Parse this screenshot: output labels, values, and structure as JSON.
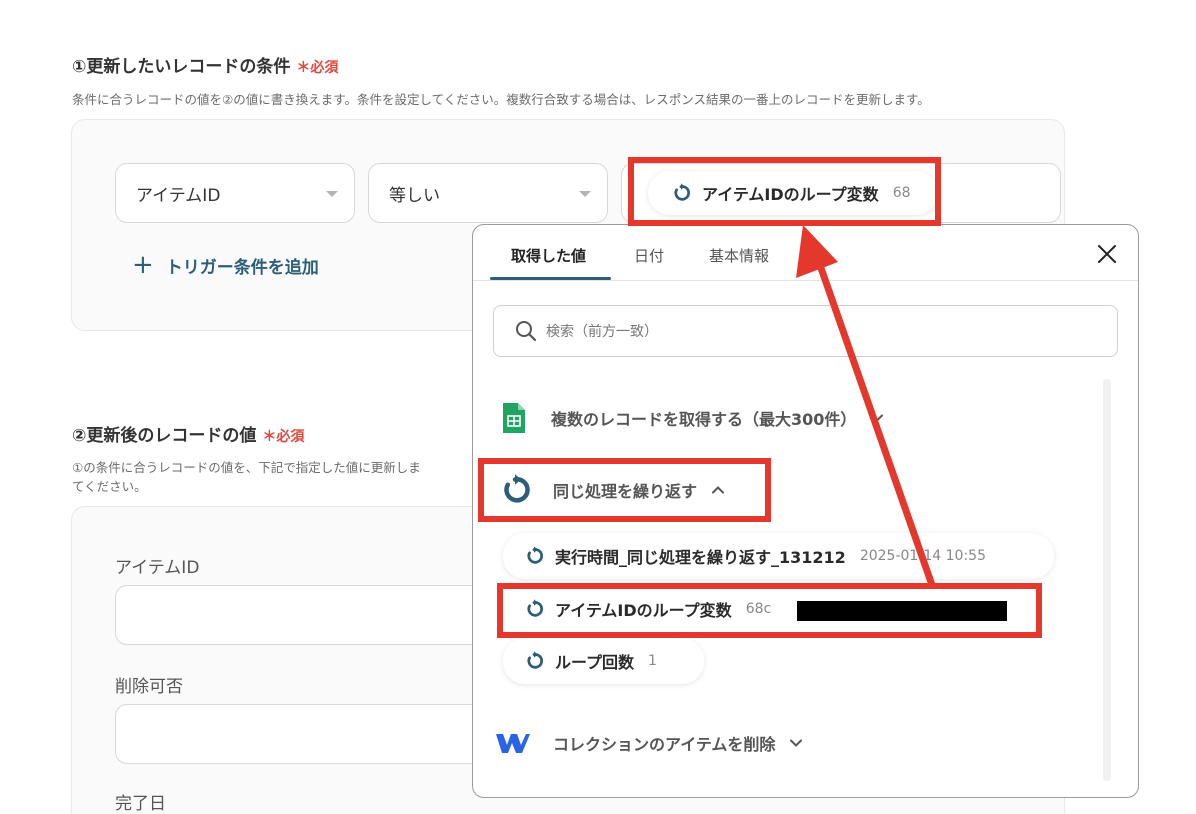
{
  "section1": {
    "title": "①更新したいレコードの条件",
    "required": "＊必須",
    "description": "条件に合うレコードの値を②の値に書き換えます。条件を設定してください。複数行合致する場合は、レスポンス結果の一番上のレコードを更新します。",
    "field_select": "アイテムID",
    "operator_select": "等しい",
    "value_chip": {
      "label": "アイテムIDのループ変数",
      "value": "68"
    },
    "add_condition": "トリガー条件を追加"
  },
  "section2": {
    "title": "②更新後のレコードの値",
    "required": "＊必須",
    "description_line1": "①の条件に合うレコードの値を、下記で指定した値に更新しま",
    "description_line2": "てください。",
    "fields": [
      "アイテムID",
      "削除可否",
      "完了日"
    ]
  },
  "popup": {
    "tabs": [
      "取得した値",
      "日付",
      "基本情報"
    ],
    "active_tab": "取得した値",
    "search_placeholder": "検索（前方一致）",
    "groups": [
      {
        "label": "複数のレコードを取得する（最大300件）",
        "icon": "spreadsheet-icon",
        "expanded": false
      },
      {
        "label": "同じ処理を繰り返す",
        "icon": "loop-icon",
        "expanded": true
      },
      {
        "label": "コレクションのアイテムを削除",
        "icon": "webflow-icon",
        "expanded": false
      }
    ],
    "loop_items": [
      {
        "label": "実行時間_同じ処理を繰り返す_131212",
        "value": "2025-01-14 10:55"
      },
      {
        "label": "アイテムIDのループ変数",
        "value": "68c"
      },
      {
        "label": "ループ回数",
        "value": "1"
      }
    ]
  },
  "colors": {
    "accent": "#2c5e7a",
    "highlight": "#e4382c",
    "required": "#e2483c"
  }
}
